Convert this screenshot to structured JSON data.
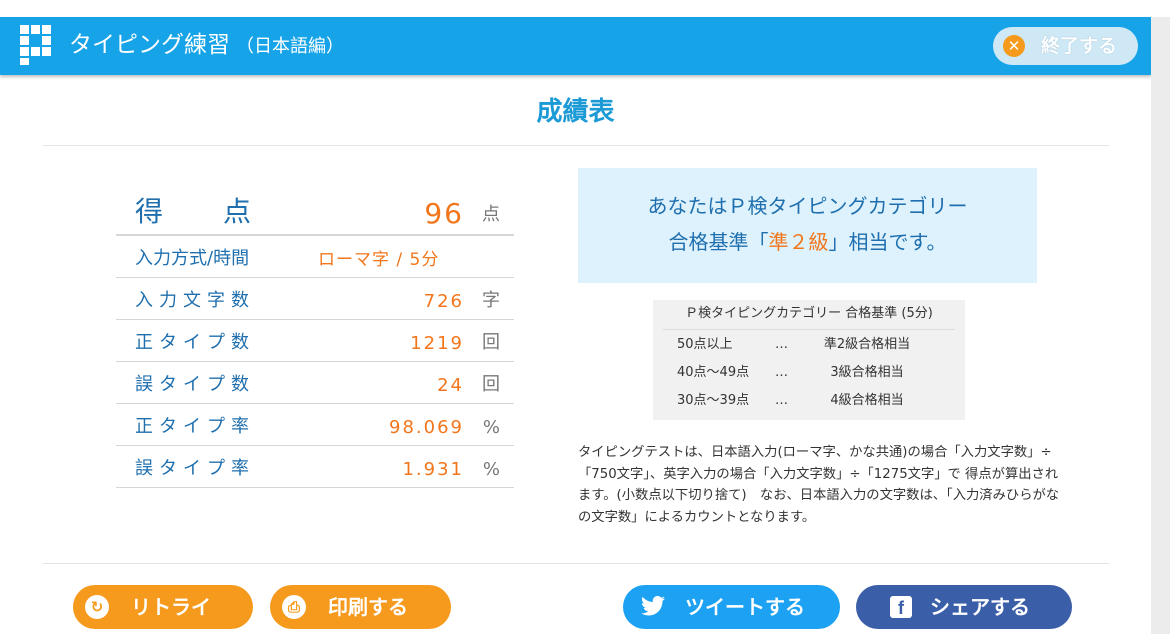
{
  "header": {
    "title": "タイピング練習",
    "subtitle": "（日本語編）",
    "end_button": "終了する"
  },
  "page_title": "成績表",
  "score": {
    "label": "得点",
    "value": "96",
    "unit": "点"
  },
  "rows": [
    {
      "label": "入力方式/時間",
      "value": "ローマ字 / 5分",
      "unit": ""
    },
    {
      "label": "入力文字数",
      "value": "726",
      "unit": "字"
    },
    {
      "label": "正タイプ数",
      "value": "1219",
      "unit": "回"
    },
    {
      "label": "誤タイプ数",
      "value": "24",
      "unit": "回"
    },
    {
      "label": "正タイプ率",
      "value": "98.069",
      "unit": "%"
    },
    {
      "label": "誤タイプ率",
      "value": "1.931",
      "unit": "%"
    }
  ],
  "grade": {
    "line1": "あなたはＰ検タイピングカテゴリー",
    "line2_pre": "合格基準「",
    "line2_grade": "準２級",
    "line2_post": "」相当です。"
  },
  "criteria": {
    "title": "Ｐ検タイピングカテゴリー 合格基準 (5分)",
    "rows": [
      {
        "range": "50点以上",
        "sep": "…",
        "level": "準2級合格相当"
      },
      {
        "range": "40点～49点",
        "sep": "…",
        "level": "3級合格相当"
      },
      {
        "range": "30点～39点",
        "sep": "…",
        "level": "4級合格相当"
      }
    ]
  },
  "description": "タイピングテストは、日本語入力(ローマ字、かな共通)の場合「入力文字数」÷「750文字」、英字入力の場合「入力文字数」÷「1275文字」で 得点が算出されます。(小数点以下切り捨て)　なお、日本語入力の文字数は、「入力済みひらがなの文字数」によるカウントとなります。",
  "buttons": {
    "retry": "リトライ",
    "print": "印刷する",
    "tweet": "ツイートする",
    "share": "シェアする"
  },
  "colors": {
    "header": "#17a3e8",
    "accent_orange": "#f59a1d",
    "value_orange": "#f2761c",
    "label_blue": "#1f6fae",
    "twitter": "#1da1f2",
    "facebook": "#3b5ea8"
  }
}
